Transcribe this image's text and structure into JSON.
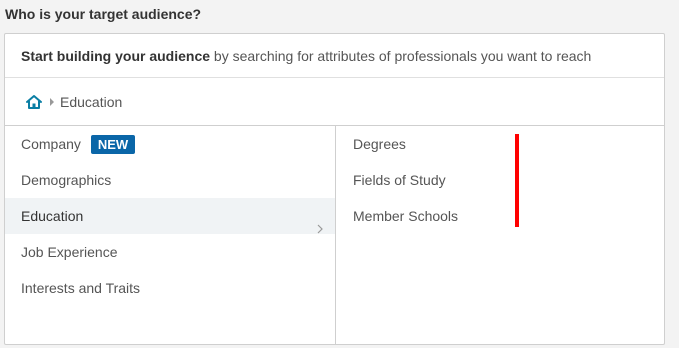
{
  "question": "Who is your target audience?",
  "intro": {
    "bold": "Start building your audience",
    "rest": " by searching for attributes of professionals you want to reach"
  },
  "breadcrumb": {
    "home_icon": "home-icon",
    "current": "Education"
  },
  "categories": [
    {
      "label": "Company",
      "badge": "NEW"
    },
    {
      "label": "Demographics"
    },
    {
      "label": "Education",
      "active": true
    },
    {
      "label": "Job Experience"
    },
    {
      "label": "Interests and Traits"
    }
  ],
  "subcategories": [
    "Degrees",
    "Fields of Study",
    "Member Schools"
  ],
  "colors": {
    "accent": "#0a66a8",
    "home_icon": "#0a7ea4",
    "active_row_bg": "#f0f3f5",
    "marker": "#ff0000"
  }
}
